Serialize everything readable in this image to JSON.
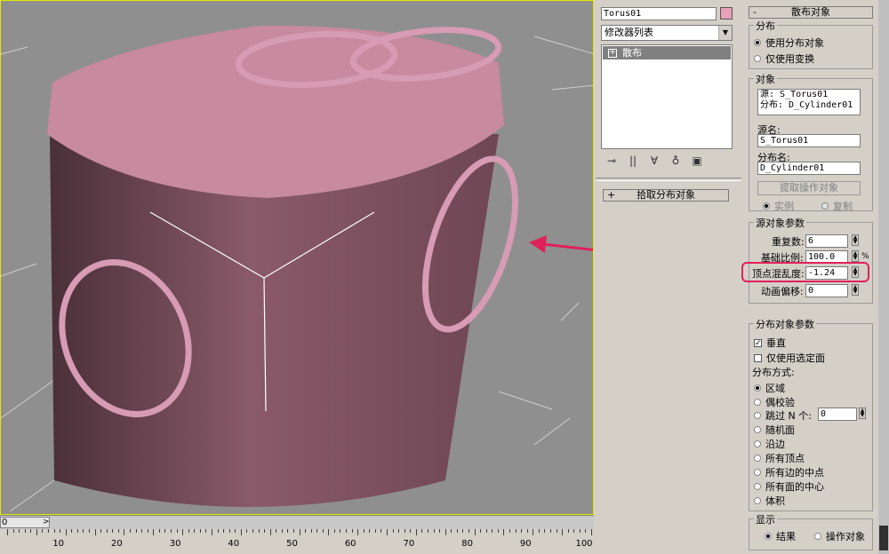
{
  "colors": {
    "viewport_bg": "#8f8f8f",
    "cylinder_top": "#c78a9e",
    "cylinder_side": "#8a5a6a",
    "torus": "#d79bb4",
    "highlight": "#e0205a",
    "active_border": "#e8e800"
  },
  "timeline": {
    "slider_value": "0",
    "ruler_labels": [
      "10",
      "20",
      "30",
      "40",
      "50",
      "60",
      "70",
      "80",
      "90",
      "100"
    ]
  },
  "modify_panel": {
    "object_name": "Torus01",
    "modifier_list": "修改器列表",
    "stack_item": "散布",
    "pick_rollout": "拾取分布对象"
  },
  "scatter": {
    "rollout_title": "散布对象",
    "distribution": {
      "title": "分布",
      "use_distribution_object": "使用分布对象",
      "use_transform_only": "仅使用变换"
    },
    "objects": {
      "title": "对象",
      "source_line": "源: S_Torus01",
      "dist_line": "分布: D_Cylinder01",
      "source_name_label": "源名:",
      "source_name_value": "S_Torus01",
      "dist_name_label": "分布名:",
      "dist_name_value": "D_Cylinder01",
      "extract_button": "提取操作对象",
      "instance": "实例",
      "copy": "复制"
    },
    "source_params": {
      "title": "源对象参数",
      "duplicates_label": "重复数:",
      "duplicates_value": "6",
      "base_scale_label": "基础比例:",
      "base_scale_value": "100.0",
      "percent": "%",
      "vertex_chaos_label": "顶点混乱度:",
      "vertex_chaos_value": "-1.24",
      "anim_offset_label": "动画偏移:",
      "anim_offset_value": "0"
    },
    "dist_params": {
      "title": "分布对象参数",
      "perpendicular": "垂直",
      "use_selected_faces": "仅使用选定面",
      "method_label": "分布方式:",
      "area": "区域",
      "even": "偶校验",
      "skip_n": "跳过 N 个:",
      "skip_n_value": "0",
      "random_faces": "随机面",
      "along_edges": "沿边",
      "all_vertices": "所有顶点",
      "all_edge_midpoints": "所有边的中点",
      "all_face_centers": "所有面的中心",
      "volume": "体积"
    },
    "display": {
      "title": "显示",
      "result": "结果",
      "operands": "操作对象"
    }
  }
}
